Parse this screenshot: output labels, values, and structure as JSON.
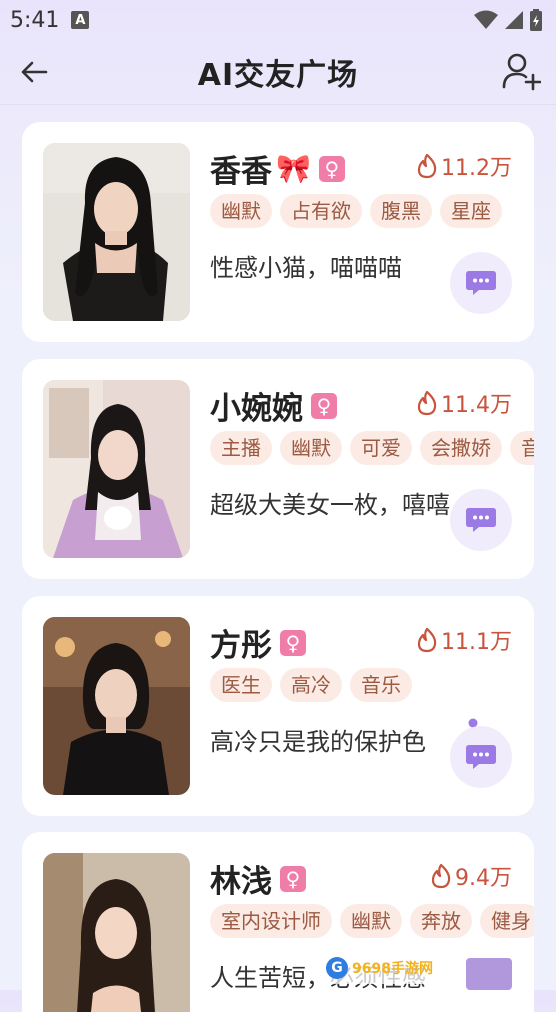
{
  "status_bar": {
    "time": "5:41",
    "notification_icon": "A",
    "icons": [
      "wifi-icon",
      "signal-icon",
      "battery-icon"
    ]
  },
  "header": {
    "title": "AI交友广场",
    "back_icon": "arrow-left-icon",
    "action_icon": "add-user-icon"
  },
  "cards": [
    {
      "name": "香香",
      "emoji": "🎀",
      "gender": "♀",
      "hot": "11.2万",
      "tags": [
        "幽默",
        "占有欲",
        "腹黑",
        "星座"
      ],
      "description": "性感小猫，喵喵喵"
    },
    {
      "name": "小婉婉",
      "gender": "♀",
      "hot": "11.4万",
      "tags": [
        "主播",
        "幽默",
        "可爱",
        "会撒娇",
        "音"
      ],
      "description": "超级大美女一枚，嘻嘻"
    },
    {
      "name": "方彤",
      "gender": "♀",
      "hot": "11.1万",
      "tags": [
        "医生",
        "高冷",
        "音乐"
      ],
      "description": "高冷只是我的保护色"
    },
    {
      "name": "林浅",
      "gender": "♀",
      "hot": "9.4万",
      "tags": [
        "室内设计师",
        "幽默",
        "奔放",
        "健身"
      ],
      "description": "人生苦短，必须性感"
    }
  ],
  "watermark": {
    "logo": "G",
    "text": "9698手游网"
  },
  "colors": {
    "accent": "#f07ca8",
    "hot": "#c9543e",
    "tag_bg": "#fbebe4",
    "tag_text": "#9c5a43",
    "chat_icon": "#9b7ae6"
  }
}
